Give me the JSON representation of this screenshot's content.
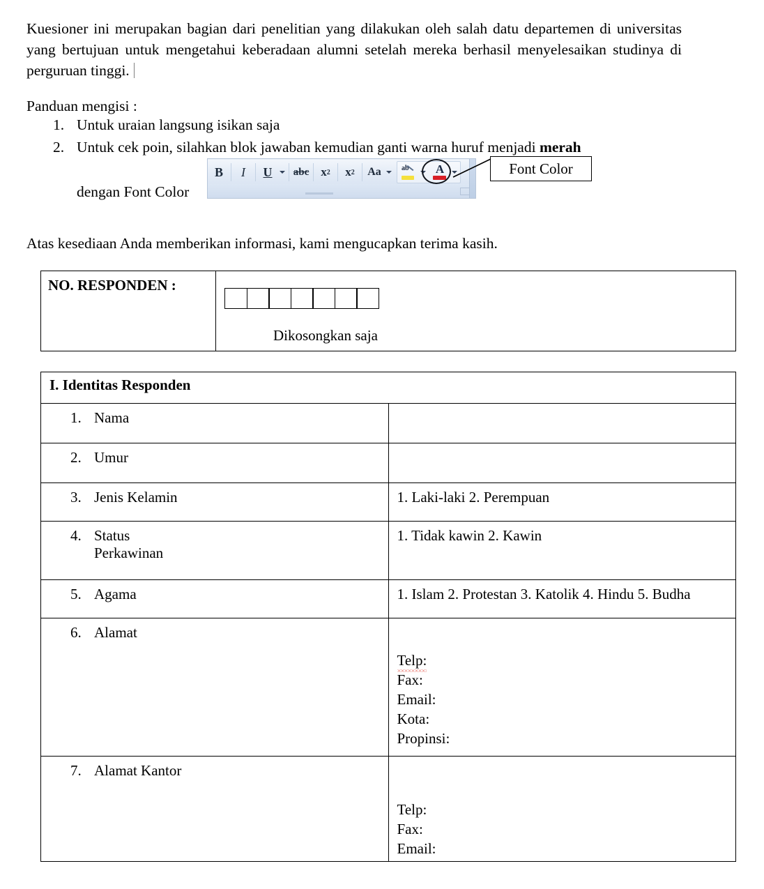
{
  "document": {
    "intro_paragraph": "Kuesioner ini merupakan bagian dari penelitian yang dilakukan oleh salah datu departemen di universitas yang bertujuan untuk mengetahui keberadaan alumni setelah mereka berhasil menyelesaikan studinya di perguruan tinggi.",
    "panduan_title": "Panduan mengisi :",
    "panduan_items": [
      {
        "num": "1.",
        "text_before": "Untuk uraian langsung isikan saja",
        "emphasis": "",
        "text_after": ""
      },
      {
        "num": "2.",
        "text_before": "Untuk cek poin, silahkan blok jawaban kemudian ganti warna huruf menjadi ",
        "emphasis": "merah",
        "text_after": ""
      }
    ],
    "dengan_line": "dengan Font Color",
    "thanks_line": "Atas kesediaan Anda memberikan informasi, kami mengucapkan terima kasih."
  },
  "toolbar_screenshot": {
    "buttons": [
      {
        "name": "bold",
        "glyph": "B"
      },
      {
        "name": "italic",
        "glyph": "I"
      },
      {
        "name": "underline",
        "glyph": "U"
      },
      {
        "name": "strikethrough",
        "glyph": "abc"
      },
      {
        "name": "subscript",
        "glyph": "x",
        "script": "2"
      },
      {
        "name": "superscript",
        "glyph": "x",
        "script": "2"
      },
      {
        "name": "change-case",
        "glyph": "Aa"
      },
      {
        "name": "text-highlight-color",
        "glyph": "ab"
      },
      {
        "name": "font-color",
        "glyph": "A"
      }
    ],
    "highlight_color": "#f5e03c",
    "font_color_swatch": "#d81f26",
    "callout_label": "Font Color"
  },
  "responden_table": {
    "label": "NO. RESPONDEN :",
    "box_count": 7,
    "note": "Dikosongkan saja"
  },
  "identitas_table": {
    "heading": "I. Identitas Responden",
    "rows": [
      {
        "num": "1.",
        "label": "Nama",
        "answer": ""
      },
      {
        "num": "2.",
        "label": "Umur",
        "answer": ""
      },
      {
        "num": "3.",
        "label": "Jenis Kelamin",
        "answer": "1. Laki-laki  2. Perempuan"
      },
      {
        "num": "4.",
        "label": "Status Perkawinan",
        "label_line1": "Status",
        "label_line2": "Perkawinan",
        "answer": "1. Tidak kawin  2. Kawin"
      },
      {
        "num": "5.",
        "label": "Agama",
        "answer": "1. Islam  2. Protestan  3. Katolik  4. Hindu  5. Budha"
      },
      {
        "num": "6.",
        "label": "Alamat",
        "answer_fields": [
          "Telp:",
          "Fax:",
          "Email:",
          "Kota:",
          "Propinsi:"
        ]
      },
      {
        "num": "7.",
        "label": "Alamat Kantor",
        "answer_fields": [
          "Telp:",
          "Fax:",
          "Email:"
        ]
      }
    ]
  }
}
